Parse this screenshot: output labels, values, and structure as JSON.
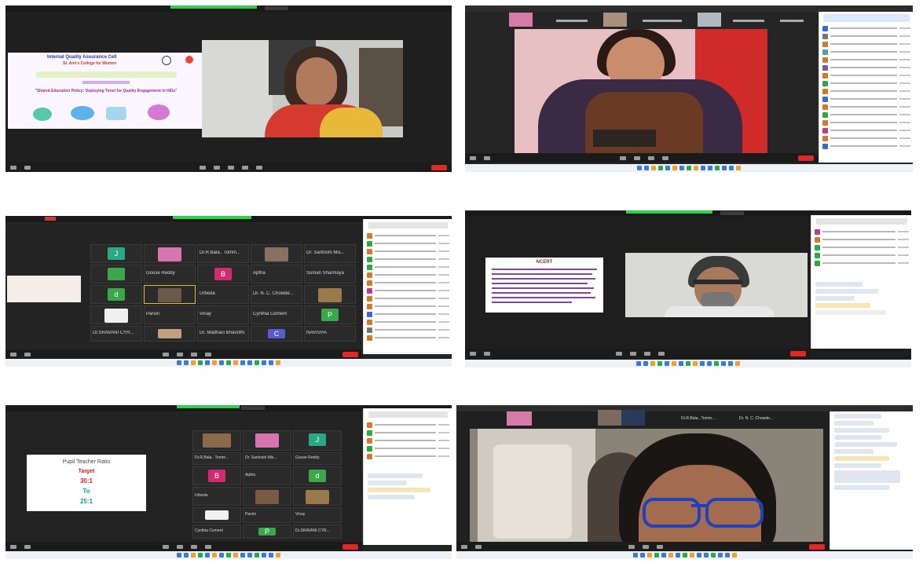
{
  "panels": {
    "p1": {
      "slide_title": "Internal Quality Assurance Cell",
      "college": "St. Ann's College for Women",
      "theme": "\"Shared Education Policy: Deploying Tenet for Quality Engagement in HEIs\""
    },
    "p3": {
      "tile_names": [
        "Dr.R.Bala.. Tomm...",
        "Dr. Santoshi Mis...",
        "Gouse Reddy",
        "Aptha",
        "Suman Sharmaya",
        "Urbeda",
        "Dr. N. C. Chowde...",
        "Parvin",
        "Vinay",
        "Cynthia Cement",
        "Dr.SRAVANI CYR...",
        "Dr. Madhavi Bhavothi",
        "NAVISHA"
      ],
      "tile_initials": [
        "J",
        "B",
        "d",
        "P",
        "C"
      ]
    },
    "p4": {
      "slide_title": "NCERT"
    },
    "p5": {
      "slide_lines": [
        "Pupil Teacher Ratio",
        "Target",
        "30:1",
        "To",
        "25:1"
      ]
    },
    "p6": {
      "top_names": [
        "Dr.R.Bala.. Tomm...",
        "Dr. N. C. Chowde..."
      ]
    }
  },
  "colors": {
    "zoom_dark": "#1f1f1f",
    "end_red": "#e02828",
    "start_green": "#2ad14a",
    "target_red": "#e02020",
    "ratio_teal": "#1aa088"
  }
}
